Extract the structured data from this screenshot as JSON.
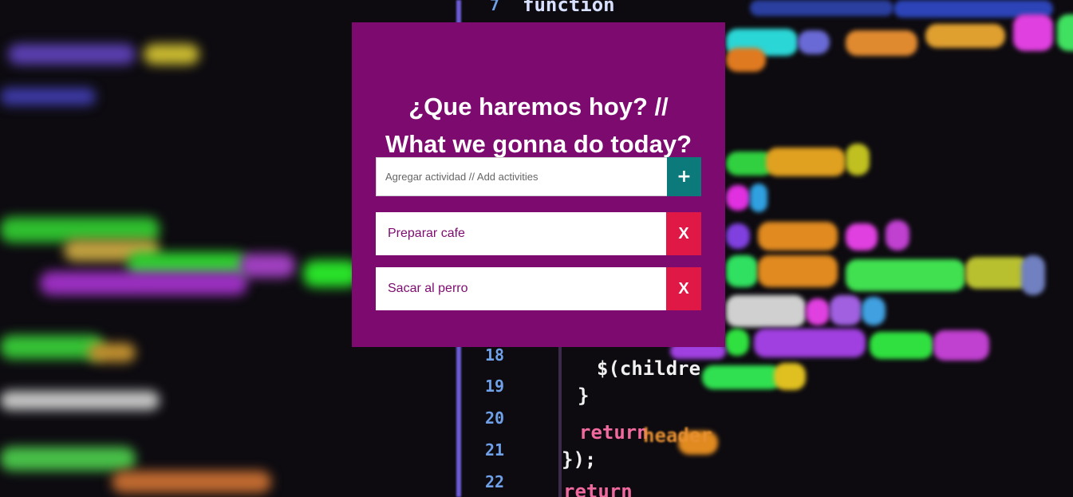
{
  "header": {
    "title_line1": "¿Que haremos hoy? //",
    "title_line2": "What we gonna do today?"
  },
  "add_form": {
    "placeholder": "Agregar actividad // Add activities",
    "value": "",
    "add_button_label": "+"
  },
  "tasks": [
    {
      "label": "Preparar cafe",
      "delete_label": "X"
    },
    {
      "label": "Sacar al perro",
      "delete_label": "X"
    }
  ],
  "colors": {
    "card": "#7d0b6f",
    "add_button": "#0c7a7a",
    "delete_button": "#e01846",
    "task_text": "#7d0b6f"
  }
}
